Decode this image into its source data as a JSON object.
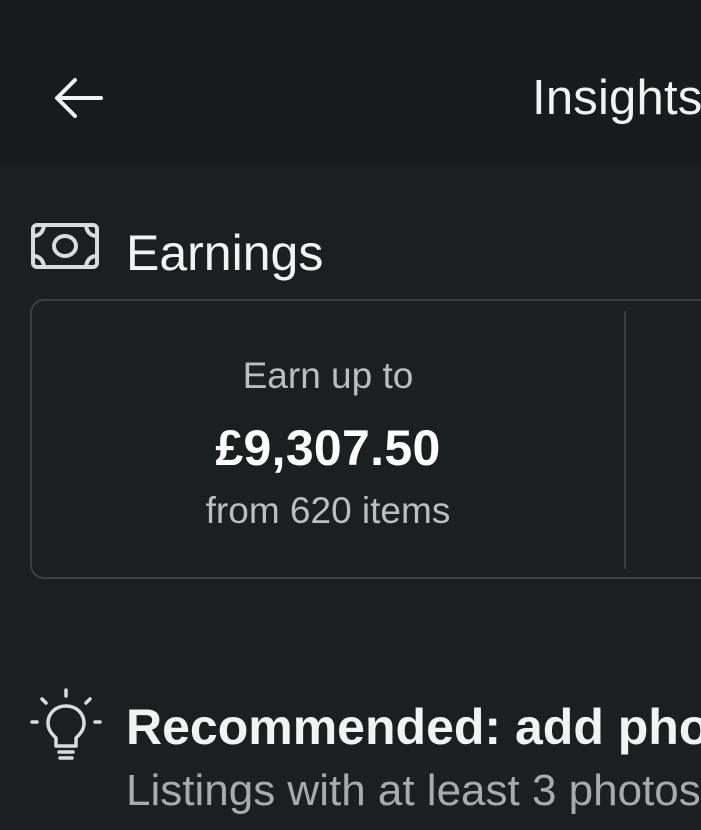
{
  "header": {
    "back_icon": "arrow-left-icon",
    "title": "Insights"
  },
  "earnings": {
    "icon": "money-icon",
    "section_title": "Earnings",
    "label": "Earn up to",
    "amount": "£9,307.50",
    "subtext": "from 620 items"
  },
  "recommendation": {
    "icon": "lightbulb-icon",
    "title": "Recommended: add photos",
    "subtitle": "Listings with at least 3 photos"
  },
  "colors": {
    "background": "#1b1f1f",
    "header_background": "#171b1b",
    "text_primary": "#f2f4f4",
    "text_secondary": "#b9bfbf",
    "border": "#3a3f3f"
  }
}
